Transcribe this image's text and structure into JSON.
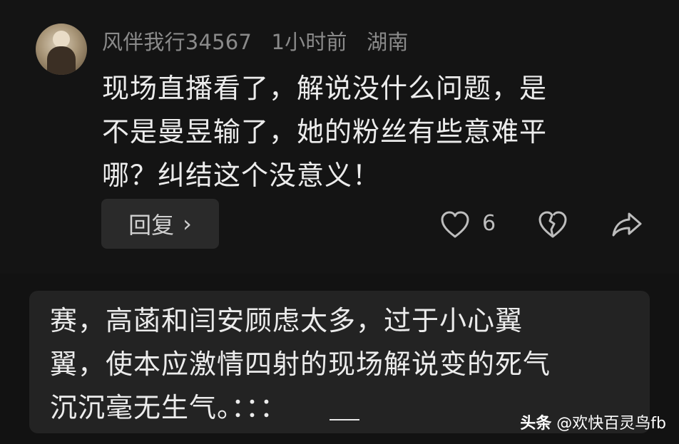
{
  "comment": {
    "username": "风伴我行34567",
    "time": "1小时前",
    "location": "湖南",
    "lines": [
      "现场直播看了，解说没什么问题，是",
      "不是曼昱输了，她的粉丝有些意难平",
      "哪？纠结这个没意义！"
    ],
    "reply_label": "回复",
    "reply_chevron": "›",
    "like_count": "6",
    "icons": {
      "like": "heart-outline-icon",
      "dislike": "broken-heart-icon",
      "share": "share-arrow-icon"
    }
  },
  "quote": {
    "lines": [
      "赛，高菡和闫安顾虑太多，过于小心翼",
      "翼，使本应激情四射的现场解说变的死气",
      "沉沉毫无生气。：：："
    ]
  },
  "watermark": {
    "brand": "头条",
    "handle": "@欢快百灵鸟fb"
  },
  "colors": {
    "background": "#141414",
    "quote_background": "#232323",
    "meta_text": "#8a8a8a",
    "body_text": "#ececec",
    "button_bg": "#2a2a2a"
  }
}
